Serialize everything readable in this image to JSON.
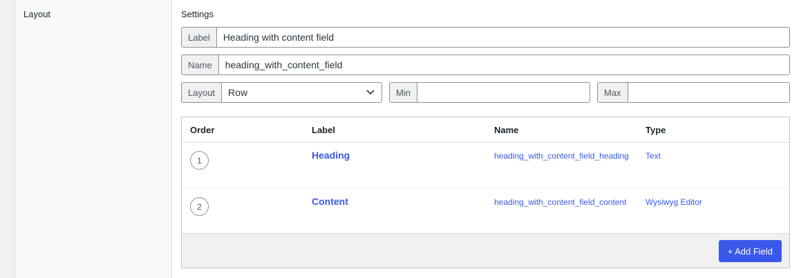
{
  "section": {
    "label": "Layout"
  },
  "settings": {
    "title": "Settings",
    "label_field": {
      "prefix": "Label",
      "value": "Heading with content field"
    },
    "name_field": {
      "prefix": "Name",
      "value": "heading_with_content_field"
    },
    "layout_field": {
      "prefix": "Layout",
      "value": "Row"
    },
    "min_field": {
      "prefix": "Min",
      "value": ""
    },
    "max_field": {
      "prefix": "Max",
      "value": ""
    }
  },
  "table": {
    "headers": {
      "order": "Order",
      "label": "Label",
      "name": "Name",
      "type": "Type"
    },
    "rows": [
      {
        "order": "1",
        "label": "Heading",
        "name": "heading_with_content_field_heading",
        "type": "Text"
      },
      {
        "order": "2",
        "label": "Content",
        "name": "heading_with_content_field_content",
        "type": "Wysiwyg Editor"
      }
    ],
    "add_button": "+ Add Field"
  },
  "colors": {
    "accent": "#3858e9"
  }
}
